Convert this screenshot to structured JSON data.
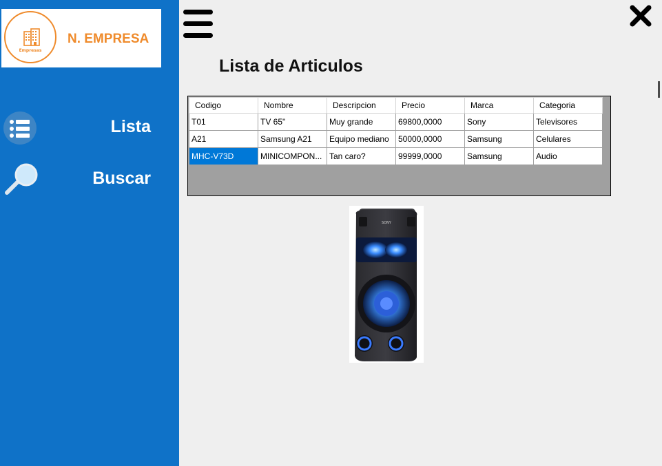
{
  "brand": {
    "name": "N. EMPRESA",
    "logo_caption": "Empresas",
    "accent_color": "#ef8b2c",
    "sidebar_color": "#0f72c8"
  },
  "sidebar": {
    "items": [
      {
        "label": "Lista",
        "icon": "list-icon"
      },
      {
        "label": "Buscar",
        "icon": "magnifier-icon"
      }
    ]
  },
  "header": {
    "menu_icon": "hamburger-icon",
    "close_icon": "close-icon"
  },
  "main": {
    "title": "Lista de Articulos",
    "table": {
      "columns": [
        "Codigo",
        "Nombre",
        "Descripcion",
        "Precio",
        "Marca",
        "Categoria"
      ],
      "rows": [
        [
          "T01",
          "TV 65\"",
          "Muy grande",
          "69800,0000",
          "Sony",
          "Televisores"
        ],
        [
          "A21",
          "Samsung A21",
          "Equipo mediano",
          "50000,0000",
          "Samsung",
          "Celulares"
        ],
        [
          "MHC-V73D",
          "MINICOMPON...",
          "Tan caro?",
          "99999,0000",
          "Samsung",
          "Audio"
        ]
      ],
      "selected_row": 2,
      "selection_color": "#0078d7"
    },
    "product_image": {
      "brand_text": "SONY"
    }
  }
}
